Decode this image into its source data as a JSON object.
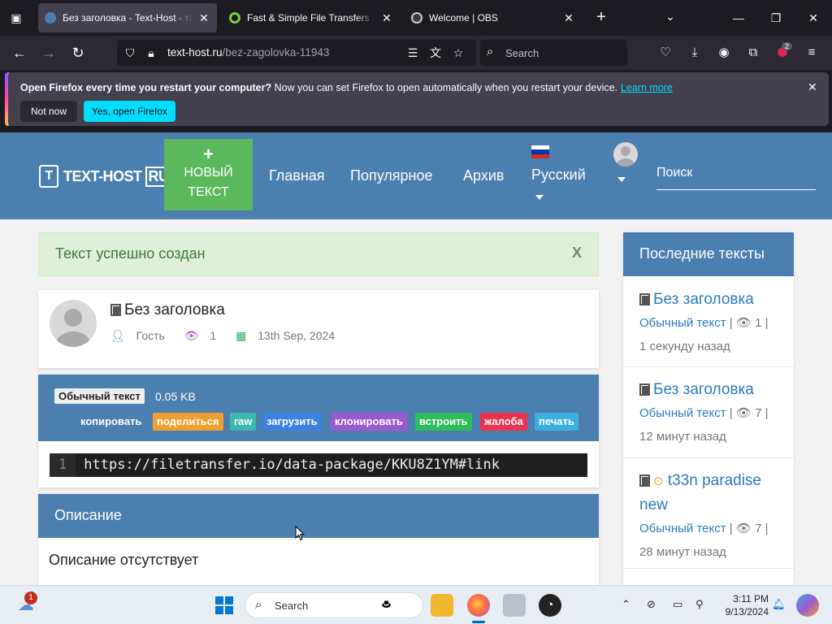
{
  "browser": {
    "tabs": [
      {
        "title": "Без заголовка - Text-Host - тек",
        "active": true
      },
      {
        "title": "Fast & Simple File Transfers - Fi",
        "active": false
      },
      {
        "title": "Welcome | OBS",
        "active": false
      }
    ],
    "url_domain": "text-host.ru",
    "url_path": "/bez-zagolovka-11943",
    "search_placeholder": "Search",
    "extension_badge": "2"
  },
  "notification": {
    "bold": "Open Firefox every time you restart your computer?",
    "text": " Now you can set Firefox to open automatically when you restart your device.",
    "learn_more": "Learn more",
    "not_now": "Not now",
    "yes_open": "Yes, open Firefox"
  },
  "site": {
    "logo_text": "TEXT-HOST",
    "logo_ru": "RU",
    "new_text_btn": {
      "plus": "+",
      "line1": "НОВЫЙ",
      "line2": "ТЕКСТ"
    },
    "nav": [
      "Главная",
      "Популярное",
      "Архив"
    ],
    "language": "Русский",
    "search_placeholder": "Поиск"
  },
  "alert": {
    "text": "Текст успешно создан",
    "close": "X"
  },
  "post": {
    "title": "Без заголовка",
    "author": "Гость",
    "views": "1",
    "date": "13th Sep, 2024",
    "type": "Обычный текст",
    "size": "0.05 KB",
    "actions": [
      {
        "label": "копировать",
        "color": "#4a7fb0"
      },
      {
        "label": "поделиться",
        "color": "#f0a030"
      },
      {
        "label": "raw",
        "color": "#3bb8b0"
      },
      {
        "label": "загрузить",
        "color": "#3b82e0"
      },
      {
        "label": "клонировать",
        "color": "#9b59d0"
      },
      {
        "label": "встроить",
        "color": "#2ebd5a"
      },
      {
        "label": "жалоба",
        "color": "#e8344e"
      },
      {
        "label": "печать",
        "color": "#3bb0e0"
      }
    ],
    "line_number": "1",
    "code": "https://filetransfer.io/data-package/KKU8Z1YM#link"
  },
  "description": {
    "heading": "Описание",
    "body": "Описание отсутствует"
  },
  "sidebar": {
    "heading": "Последние тексты",
    "items": [
      {
        "title": "Без заголовка",
        "type": "Обычный текст",
        "views": "1",
        "ago": "1 секунду назад"
      },
      {
        "title": "Без заголовка",
        "type": "Обычный текст",
        "views": "7",
        "ago": "12 минут назад"
      },
      {
        "title": "t33n paradise new",
        "type": "Обычный текст",
        "views": "7",
        "ago": "28 минут назад"
      }
    ]
  },
  "taskbar": {
    "search": "Search",
    "time": "3:11 PM",
    "date": "9/13/2024",
    "weather_badge": "1"
  }
}
